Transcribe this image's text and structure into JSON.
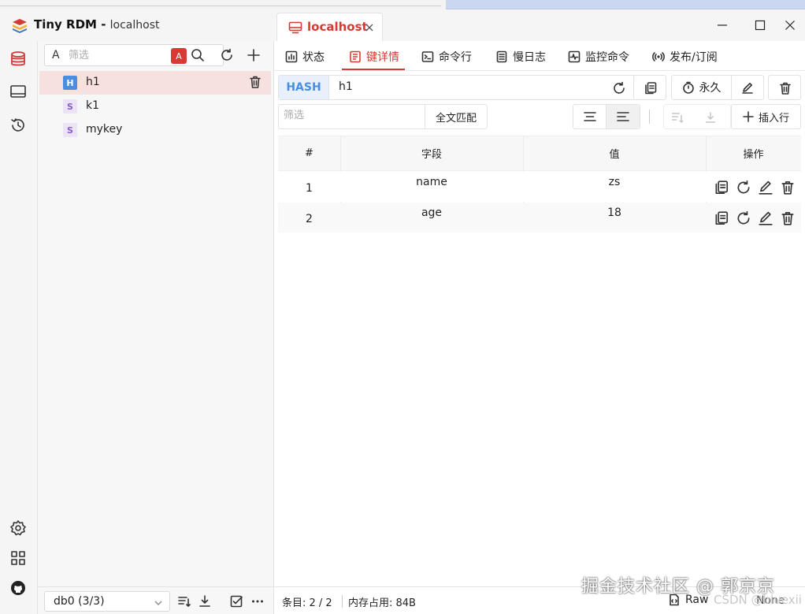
{
  "app": {
    "title": "Tiny RDM",
    "subtitle": "localhost"
  },
  "key_filter": {
    "case_label": "A",
    "placeholder": "筛选",
    "regex_label": "A"
  },
  "keys": [
    {
      "type": "H",
      "name": "h1",
      "selected": true
    },
    {
      "type": "S",
      "name": "k1",
      "selected": false
    },
    {
      "type": "S",
      "name": "mykey",
      "selected": false
    }
  ],
  "db_select": {
    "value": "db0 (3/3)"
  },
  "tab": {
    "label": "localhost"
  },
  "subtabs": [
    {
      "label": "状态",
      "icon": "status-icon"
    },
    {
      "label": "键详情",
      "icon": "key-detail-icon",
      "active": true
    },
    {
      "label": "命令行",
      "icon": "terminal-icon"
    },
    {
      "label": "慢日志",
      "icon": "slowlog-icon"
    },
    {
      "label": "监控命令",
      "icon": "monitor-icon"
    },
    {
      "label": "发布/订阅",
      "icon": "pubsub-icon"
    }
  ],
  "key_header": {
    "type": "HASH",
    "name": "h1",
    "ttl_label": "永久"
  },
  "field_filter": {
    "placeholder": "筛选",
    "fulltext_label": "全文匹配"
  },
  "insert_label": "插入行",
  "table": {
    "headers": [
      "#",
      "字段",
      "值",
      "操作"
    ],
    "rows": [
      {
        "index": "1",
        "field": "name",
        "value": "zs"
      },
      {
        "index": "2",
        "field": "age",
        "value": "18"
      }
    ]
  },
  "status": {
    "entries": "条目: 2 / 2",
    "memory": "内存占用: 84B",
    "format": "Raw",
    "decoder": "None"
  },
  "watermark": {
    "main": "掘金技术社区 @ 郭京京",
    "secondary": "CSDN @bluexii"
  },
  "colors": {
    "accent": "#d53a35",
    "hash_blue": "#4a8ee2",
    "string_purple": "#8a5bd0"
  }
}
